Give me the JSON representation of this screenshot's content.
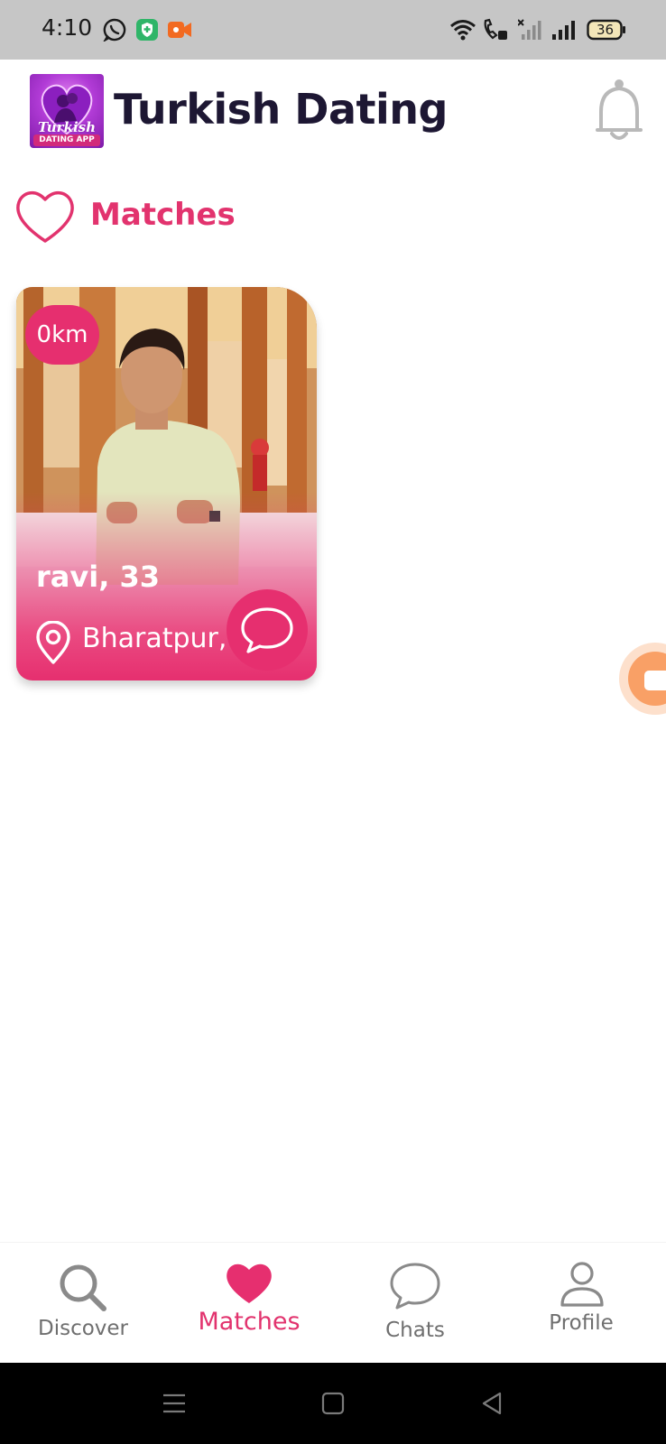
{
  "status_bar": {
    "time": "4:10",
    "battery": "36",
    "notification_icons": [
      "whatsapp-icon",
      "shield-app-icon",
      "video-app-icon"
    ],
    "system_icons": [
      "wifi-icon",
      "wifi-calling-icon",
      "no-signal-icon",
      "signal-icon",
      "battery-icon"
    ]
  },
  "header": {
    "app_name": "Turkish Dating",
    "logo": {
      "line1": "Turkish",
      "line2": "DATING APP"
    },
    "notification_icon": "bell-icon"
  },
  "section": {
    "icon": "heart-outline-icon",
    "title": "Matches"
  },
  "matches": [
    {
      "distance": "0km",
      "name_age": "ravi, 33",
      "location": "Bharatpur, ...",
      "location_icon": "location-pin-icon",
      "action_icon": "chat-bubble-icon"
    }
  ],
  "floating_button": {
    "icon": "video-camera-icon"
  },
  "bottom_nav": {
    "items": [
      {
        "label": "Discover",
        "icon": "search-icon",
        "active": false
      },
      {
        "label": "Matches",
        "icon": "heart-filled-icon",
        "active": true
      },
      {
        "label": "Chats",
        "icon": "chat-bubble-icon",
        "active": false
      },
      {
        "label": "Profile",
        "icon": "person-icon",
        "active": false
      }
    ]
  },
  "colors": {
    "accent": "#e62f6f",
    "title_text": "#1d1733",
    "inactive_nav": "#6f6f6f",
    "status_bar": "#c6c6c6"
  }
}
